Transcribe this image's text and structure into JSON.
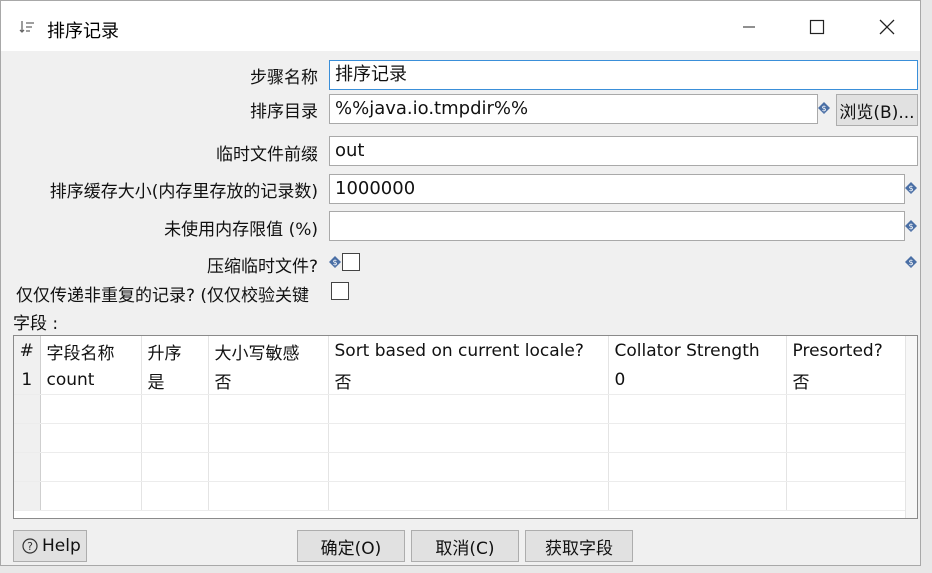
{
  "window": {
    "title": "排序记录"
  },
  "form": {
    "step_name_label": "步骤名称",
    "step_name_value": "排序记录",
    "sort_dir_label": "排序目录",
    "sort_dir_value": "%%java.io.tmpdir%%",
    "browse_label": "浏览(B)...",
    "prefix_label": "临时文件前缀",
    "prefix_value": "out",
    "buffer_label": "排序缓存大小(内存里存放的记录数)",
    "buffer_value": "1000000",
    "memory_label": "未使用内存限值 (%)",
    "memory_value": "",
    "compress_label": "压缩临时文件?",
    "unique_label": "仅仅传递非重复的记录? (仅仅校验关键",
    "fields_label": "字段 :"
  },
  "table": {
    "columns": [
      "#",
      "字段名称",
      "升序",
      "大小写敏感",
      "Sort based on current locale?",
      "Collator Strength",
      "Presorted?"
    ],
    "rows": [
      [
        "1",
        "count",
        "是",
        "否",
        "否",
        "0",
        "否"
      ]
    ]
  },
  "buttons": {
    "help": "Help",
    "ok": "确定(O)",
    "cancel": "取消(C)",
    "get_fields": "获取字段"
  },
  "colors": {
    "focus_border": "#3a8fd9",
    "variable_icon": "#4a6fa5"
  }
}
